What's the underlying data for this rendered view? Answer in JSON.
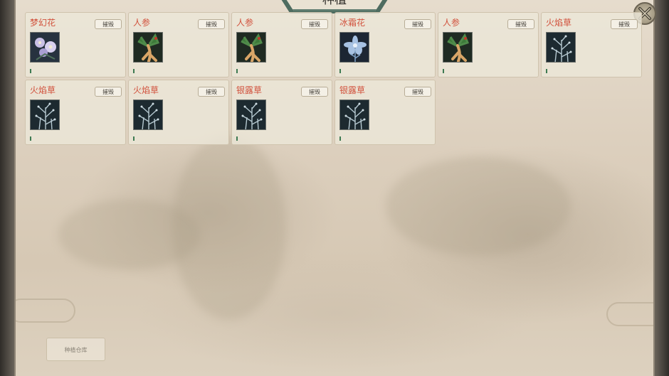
{
  "window": {
    "title": "种植"
  },
  "close": {
    "icon": "close-icon"
  },
  "plots": [
    {
      "name": "梦幻花",
      "action": "摧毁",
      "image": "dream-flower",
      "growth_progress": 0.02
    },
    {
      "name": "人参",
      "action": "摧毁",
      "image": "ginseng",
      "growth_progress": 0.02
    },
    {
      "name": "人参",
      "action": "摧毁",
      "image": "ginseng",
      "growth_progress": 0.02
    },
    {
      "name": "冰霜花",
      "action": "摧毁",
      "image": "frost-flower",
      "growth_progress": 0.02
    },
    {
      "name": "人参",
      "action": "摧毁",
      "image": "ginseng",
      "growth_progress": 0.02
    },
    {
      "name": "火焰草",
      "action": "摧毁",
      "image": "grass",
      "growth_progress": 0.02
    },
    {
      "name": "火焰草",
      "action": "摧毁",
      "image": "grass",
      "growth_progress": 0.02
    },
    {
      "name": "火焰草",
      "action": "摧毁",
      "image": "grass",
      "growth_progress": 0.02
    },
    {
      "name": "银露草",
      "action": "摧毁",
      "image": "grass",
      "growth_progress": 0.02
    },
    {
      "name": "银露草",
      "action": "摧毁",
      "image": "grass",
      "growth_progress": 0.02
    }
  ],
  "footer": {
    "warehouse_button": "种植仓库"
  },
  "colors": {
    "name_text": "#d1513c",
    "progress": "#3e7a52",
    "frame_accent": "#4e6c60"
  }
}
